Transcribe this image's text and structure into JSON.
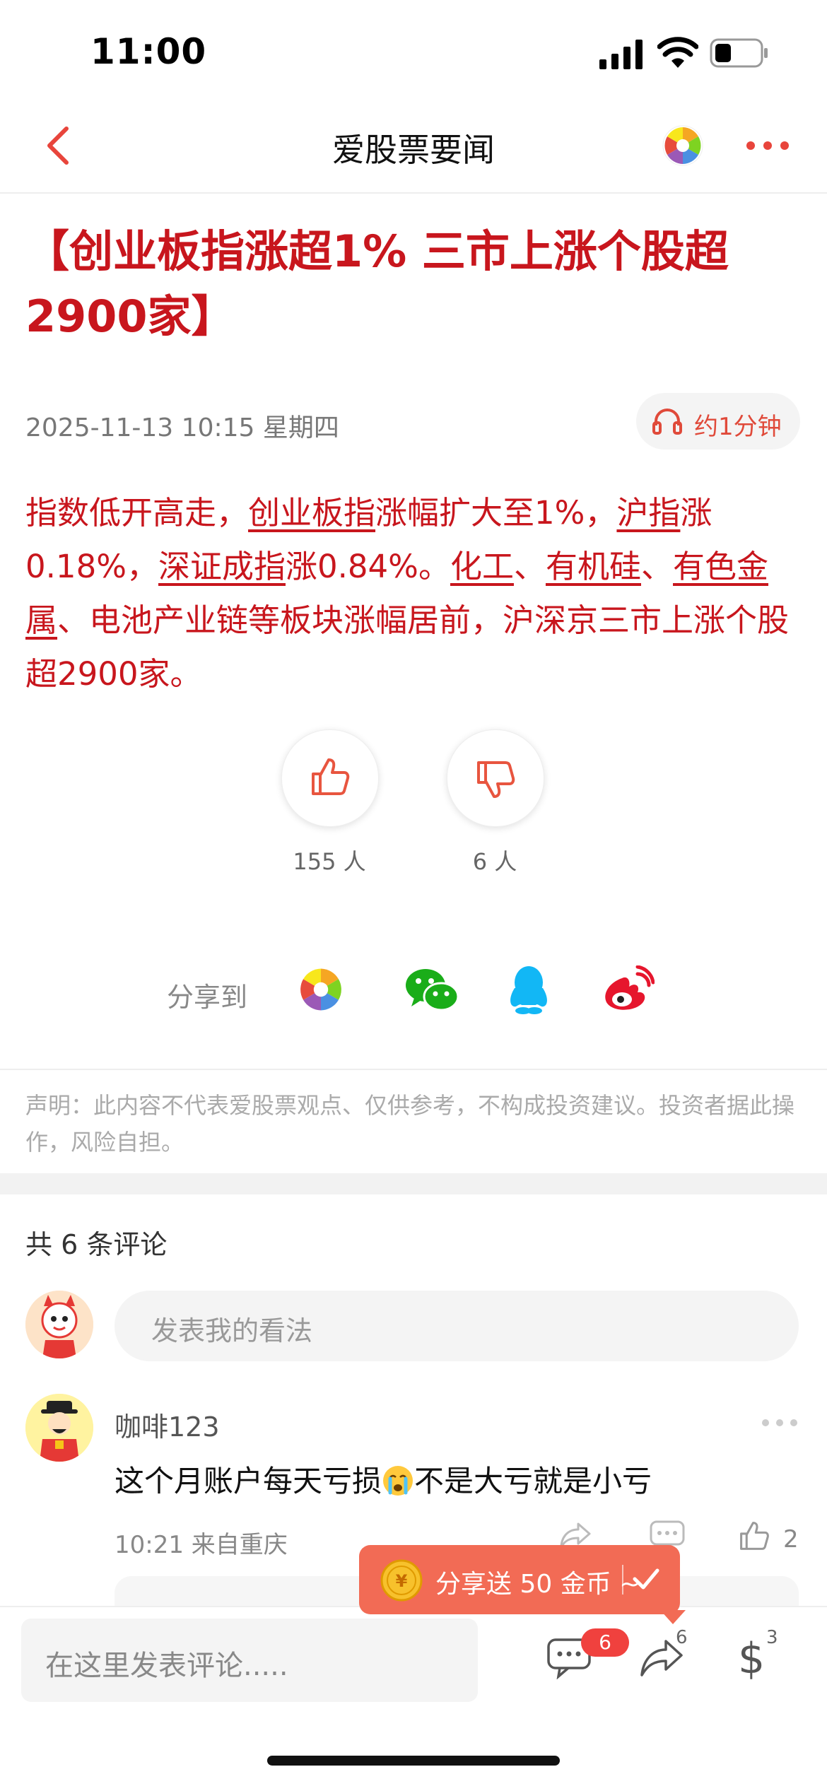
{
  "status_bar": {
    "time": "11:00"
  },
  "nav": {
    "title": "爱股票要闻"
  },
  "article": {
    "headline": "【创业板指涨超1% 三市上涨个股超2900家】",
    "date": "2025-11-13 10:15 星期四",
    "listen_label": "约1分钟",
    "body": [
      {
        "t": "指数低开高走，"
      },
      {
        "t": "创业板指",
        "link": true
      },
      {
        "t": "涨幅扩大至1%，"
      },
      {
        "t": "沪指",
        "link": true
      },
      {
        "t": "涨0.18%，"
      },
      {
        "t": "深证成指",
        "link": true
      },
      {
        "t": "涨0.84%。"
      },
      {
        "t": "化工",
        "link": true
      },
      {
        "t": "、"
      },
      {
        "t": "有机硅",
        "link": true
      },
      {
        "t": "、"
      },
      {
        "t": "有色金属",
        "link": true
      },
      {
        "t": "、电池产业链等板块涨幅居前，沪深京三市上涨个股超2900家。"
      }
    ]
  },
  "votes": {
    "like_count": "155 人",
    "dislike_count": "6 人"
  },
  "share": {
    "label": "分享到",
    "targets": [
      "aigupiao-icon",
      "wechat-icon",
      "qq-icon",
      "weibo-icon"
    ]
  },
  "disclaimer": "声明：此内容不代表爱股票观点、仅供参考，不构成投资建议。投资者据此操作，风险自担。",
  "comments": {
    "count_label": "共 6 条评论",
    "input_placeholder": "发表我的看法",
    "items": [
      {
        "user": "咖啡123",
        "text_before": "这个月账户每天亏损",
        "text_after": "不是大亏就是小亏",
        "meta": "10:21 来自重庆",
        "likes": "2"
      }
    ]
  },
  "coin_tip": {
    "text": "分享送 50 金币 ~"
  },
  "bottom_bar": {
    "input_placeholder": "在这里发表评论.....",
    "comment_badge": "6",
    "share_count": "6",
    "reward_count": "3"
  },
  "colors": {
    "accent": "#c8161d",
    "orange": "#f26b55",
    "badge": "#f0413e"
  }
}
